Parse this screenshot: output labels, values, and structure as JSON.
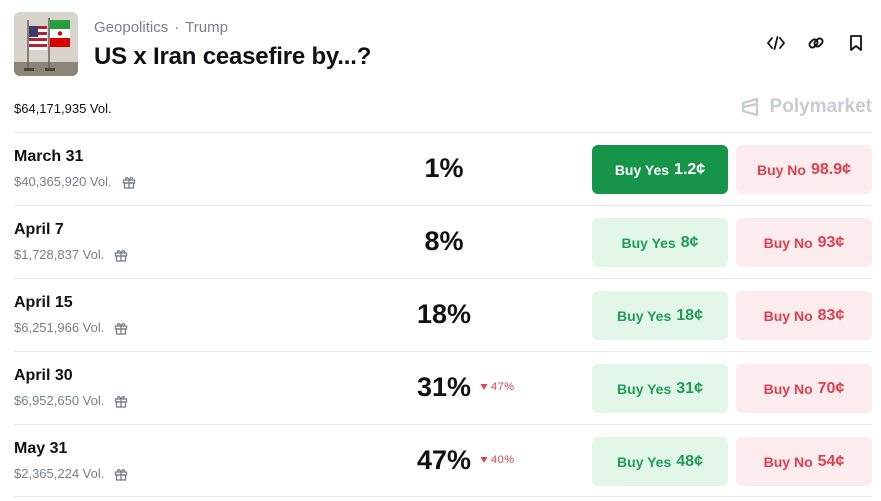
{
  "header": {
    "category": "Geopolitics",
    "separator": "·",
    "tag": "Trump",
    "title": "US x Iran ceasefire by...?"
  },
  "total_volume": "$64,171,935 Vol.",
  "brand": "Polymarket",
  "icons": [
    "code-embed-icon",
    "link-icon",
    "bookmark-icon",
    "gift-icon",
    "polymarket-logo-icon",
    "down-triangle-icon"
  ],
  "colors": {
    "yes_active_bg": "#15944a",
    "yes_bg": "#e3f6ea",
    "yes_text": "#1f9d55",
    "no_bg": "#fcecee",
    "no_text": "#e0404f"
  },
  "markets": [
    {
      "date": "March 31",
      "volume": "$40,365,920 Vol.",
      "percent": "1%",
      "change": "",
      "yes_label": "Buy Yes",
      "yes_price": "1.2¢",
      "no_label": "Buy No",
      "no_price": "98.9¢",
      "yes_active": true
    },
    {
      "date": "April 7",
      "volume": "$1,728,837 Vol.",
      "percent": "8%",
      "change": "",
      "yes_label": "Buy Yes",
      "yes_price": "8¢",
      "no_label": "Buy No",
      "no_price": "93¢",
      "yes_active": false
    },
    {
      "date": "April 15",
      "volume": "$6,251,966 Vol.",
      "percent": "18%",
      "change": "",
      "yes_label": "Buy Yes",
      "yes_price": "18¢",
      "no_label": "Buy No",
      "no_price": "83¢",
      "yes_active": false
    },
    {
      "date": "April 30",
      "volume": "$6,952,650 Vol.",
      "percent": "31%",
      "change": "47%",
      "yes_label": "Buy Yes",
      "yes_price": "31¢",
      "no_label": "Buy No",
      "no_price": "70¢",
      "yes_active": false
    },
    {
      "date": "May 31",
      "volume": "$2,365,224 Vol.",
      "percent": "47%",
      "change": "40%",
      "yes_label": "Buy Yes",
      "yes_price": "48¢",
      "no_label": "Buy No",
      "no_price": "54¢",
      "yes_active": false
    }
  ]
}
